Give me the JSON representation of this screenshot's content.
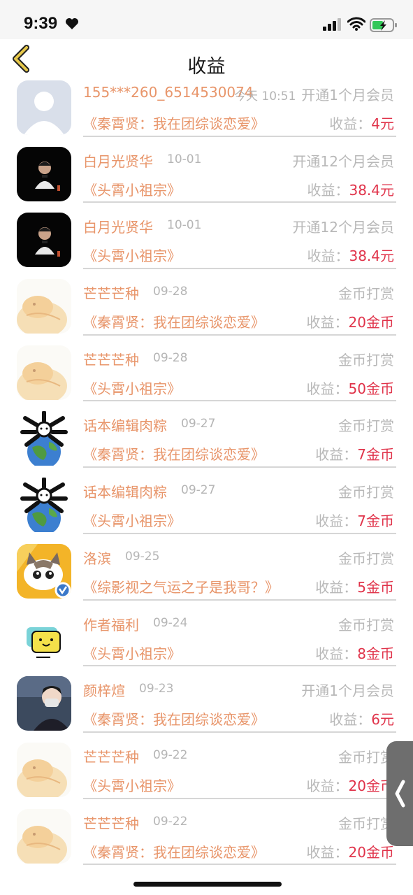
{
  "status_bar": {
    "time": "9:39"
  },
  "header": {
    "title": "收益"
  },
  "rows": [
    {
      "name": "155***260_6514530074",
      "date": "今天 10:51",
      "type": "开通1个月会员",
      "book": "《秦霄贤：我在团综谈恋爱》",
      "earn_label": "收益：",
      "earn_value": "4元",
      "avatar": "default"
    },
    {
      "name": "白月光贤华",
      "date": "10-01",
      "type": "开通12个月会员",
      "book": "《头霄小祖宗》",
      "earn_label": "收益：",
      "earn_value": "38.4元",
      "avatar": "dark"
    },
    {
      "name": "白月光贤华",
      "date": "10-01",
      "type": "开通12个月会员",
      "book": "《头霄小祖宗》",
      "earn_label": "收益：",
      "earn_value": "38.4元",
      "avatar": "dark"
    },
    {
      "name": "芒芒芒种",
      "date": "09-28",
      "type": "金币打赏",
      "book": "《秦霄贤：我在团综谈恋爱》",
      "earn_label": "收益：",
      "earn_value": "20金币",
      "avatar": "cream"
    },
    {
      "name": "芒芒芒种",
      "date": "09-28",
      "type": "金币打赏",
      "book": "《头霄小祖宗》",
      "earn_label": "收益：",
      "earn_value": "50金币",
      "avatar": "cream"
    },
    {
      "name": "话本编辑肉粽",
      "date": "09-27",
      "type": "金币打赏",
      "book": "《秦霄贤：我在团综谈恋爱》",
      "earn_label": "收益：",
      "earn_value": "7金币",
      "avatar": "globe"
    },
    {
      "name": "话本编辑肉粽",
      "date": "09-27",
      "type": "金币打赏",
      "book": "《头霄小祖宗》",
      "earn_label": "收益：",
      "earn_value": "7金币",
      "avatar": "globe"
    },
    {
      "name": "洛滨",
      "date": "09-25",
      "type": "金币打赏",
      "book": "《综影视之气运之子是我哥？》",
      "earn_label": "收益：",
      "earn_value": "5金币",
      "avatar": "cat"
    },
    {
      "name": "作者福利",
      "date": "09-24",
      "type": "金币打赏",
      "book": "《头霄小祖宗》",
      "earn_label": "收益：",
      "earn_value": "8金币",
      "avatar": "emoji"
    },
    {
      "name": "颜梓煊",
      "date": "09-23",
      "type": "开通1个月会员",
      "book": "《秦霄贤：我在团综谈恋爱》",
      "earn_label": "收益：",
      "earn_value": "6元",
      "avatar": "photo"
    },
    {
      "name": "芒芒芒种",
      "date": "09-22",
      "type": "金币打赏",
      "book": "《头霄小祖宗》",
      "earn_label": "收益：",
      "earn_value": "20金币",
      "avatar": "cream"
    },
    {
      "name": "芒芒芒种",
      "date": "09-22",
      "type": "金币打赏",
      "book": "《秦霄贤：我在团综谈恋爱》",
      "earn_label": "收益：",
      "earn_value": "20金币",
      "avatar": "cream"
    }
  ]
}
